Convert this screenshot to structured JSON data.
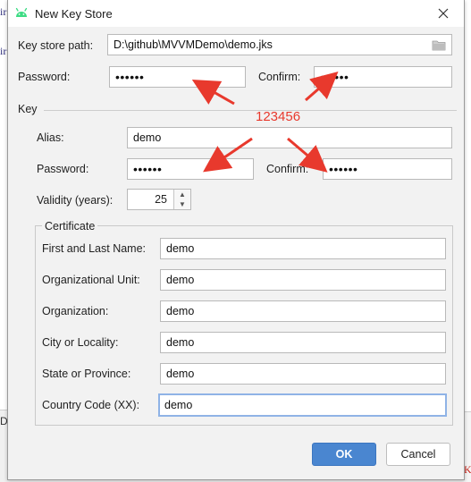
{
  "background": {
    "left_glyphs": [
      "ir",
      "ir",
      "D"
    ],
    "right_glyph": "K"
  },
  "dialog": {
    "title": "New Key Store",
    "close_icon": "close-icon",
    "app_icon": "android-icon",
    "key_store_path_label": "Key store path:",
    "key_store_path_value": "D:\\github\\MVVMDemo\\demo.jks",
    "folder_icon": "folder-icon",
    "password_label": "Password:",
    "password_value": "••••••",
    "confirm_label": "Confirm:",
    "confirm_value": "••••••",
    "key": {
      "section_label": "Key",
      "alias_label": "Alias:",
      "alias_value": "demo",
      "password_label": "Password:",
      "password_value": "••••••",
      "confirm_label": "Confirm:",
      "confirm_value": "••••••",
      "validity_label": "Validity (years):",
      "validity_value": "25"
    },
    "certificate": {
      "group_label": "Certificate",
      "first_last_label": "First and Last Name:",
      "first_last_value": "demo",
      "org_unit_label": "Organizational Unit:",
      "org_unit_value": "demo",
      "org_label": "Organization:",
      "org_value": "demo",
      "city_label": "City or Locality:",
      "city_value": "demo",
      "state_label": "State or Province:",
      "state_value": "demo",
      "country_label": "Country Code (XX):",
      "country_value": "demo"
    },
    "buttons": {
      "ok": "OK",
      "cancel": "Cancel"
    }
  },
  "annotation": {
    "text": "123456",
    "color": "#e8392d"
  }
}
